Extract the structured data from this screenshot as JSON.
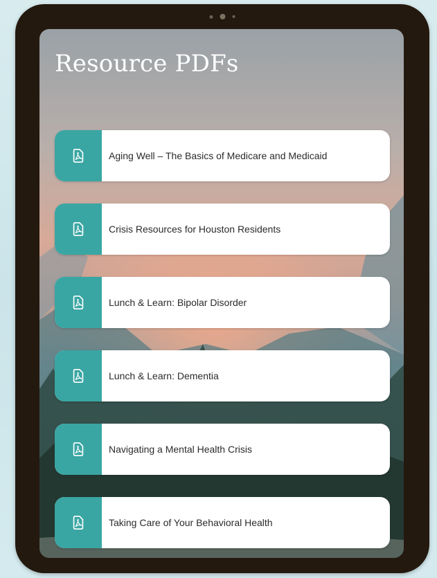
{
  "page": {
    "title": "Resource PDFs"
  },
  "theme": {
    "accent": "#3aa6a3",
    "card_bg": "#ffffff",
    "frame": "#24190f"
  },
  "items": [
    {
      "label": "Aging Well – The Basics of Medicare and Medicaid",
      "icon": "pdf-icon"
    },
    {
      "label": "Crisis Resources for Houston Residents",
      "icon": "pdf-icon"
    },
    {
      "label": "Lunch & Learn: Bipolar Disorder",
      "icon": "pdf-icon"
    },
    {
      "label": "Lunch & Learn: Dementia",
      "icon": "pdf-icon"
    },
    {
      "label": "Navigating a Mental Health Crisis",
      "icon": "pdf-icon"
    },
    {
      "label": "Taking Care of Your Behavioral Health",
      "icon": "pdf-icon"
    }
  ]
}
